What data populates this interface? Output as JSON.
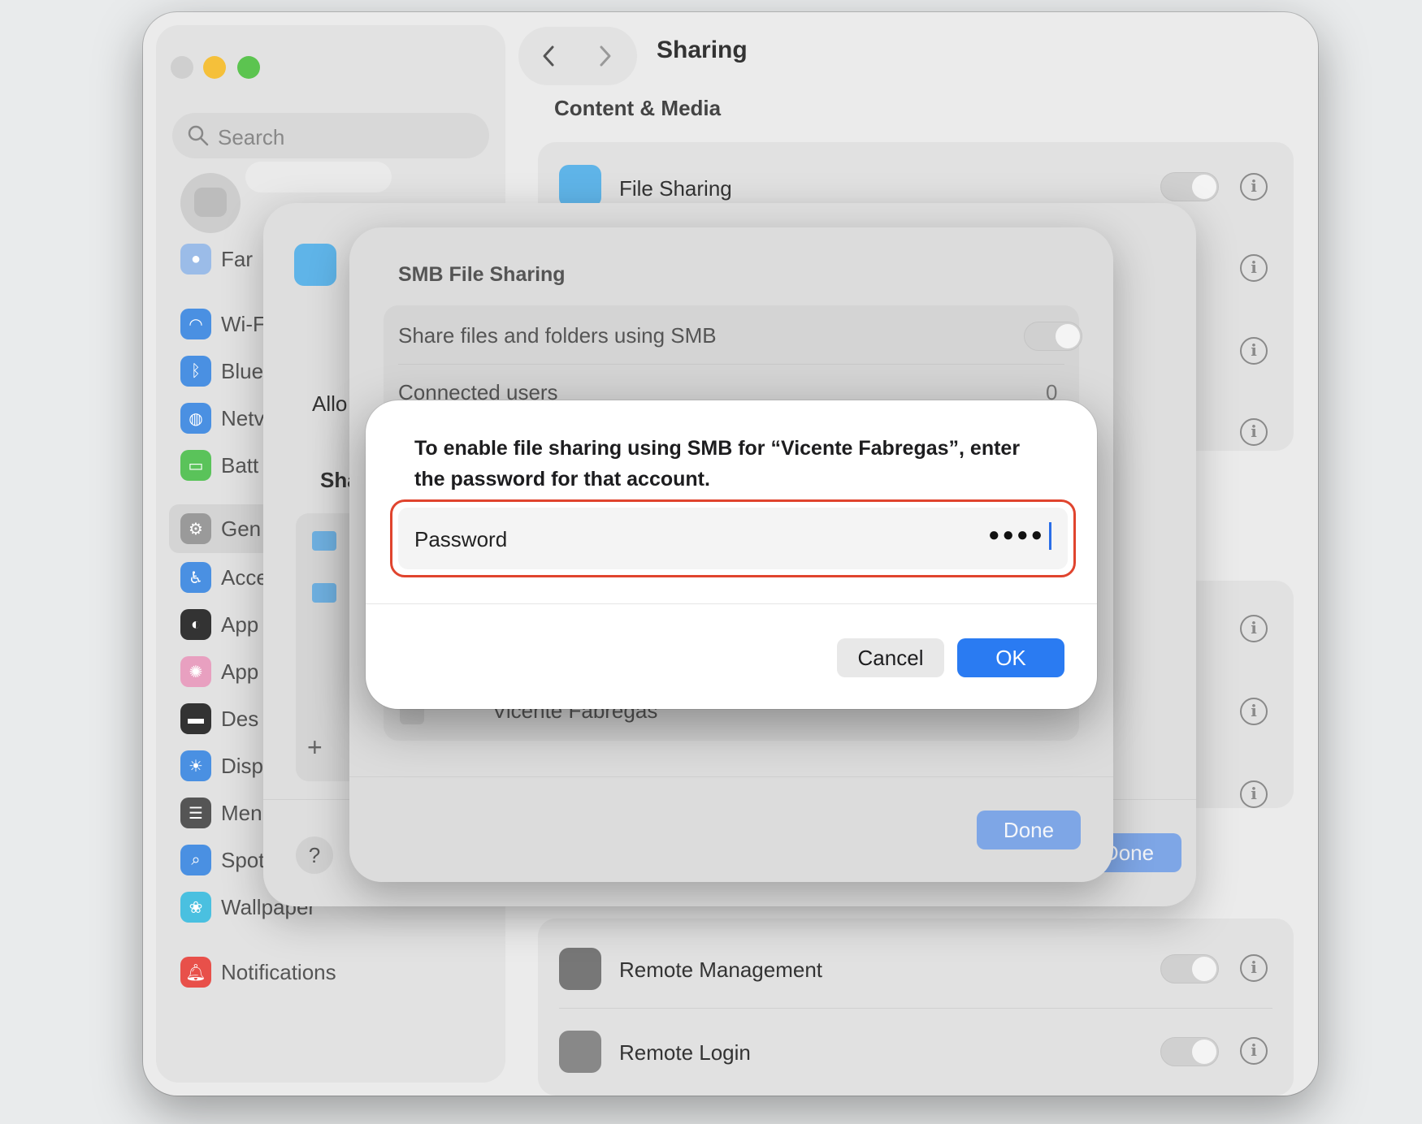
{
  "window": {
    "title": "Sharing"
  },
  "sidebar": {
    "search_placeholder": "Search",
    "items": [
      {
        "label": "Far",
        "icon": "family-icon",
        "color": "#9bbce8"
      },
      {
        "label": "Wi-F",
        "icon": "wifi-icon",
        "color": "#4a90e2"
      },
      {
        "label": "Blue",
        "icon": "bluetooth-icon",
        "color": "#4a90e2"
      },
      {
        "label": "Netv",
        "icon": "network-icon",
        "color": "#4a90e2"
      },
      {
        "label": "Batt",
        "icon": "battery-icon",
        "color": "#5ac35a"
      },
      {
        "label": "Gen",
        "icon": "gear-icon",
        "color": "#9a9a9a"
      },
      {
        "label": "Acce",
        "icon": "accessibility-icon",
        "color": "#4a90e2"
      },
      {
        "label": "App",
        "icon": "appearance-icon",
        "color": "#333333"
      },
      {
        "label": "App",
        "icon": "apple-intelligence-icon",
        "color": "#e8a0c0"
      },
      {
        "label": "Des",
        "icon": "desktop-icon",
        "color": "#333333"
      },
      {
        "label": "Disp",
        "icon": "display-icon",
        "color": "#4a90e2"
      },
      {
        "label": "Men",
        "icon": "menu-bar-icon",
        "color": "#555555"
      },
      {
        "label": "Spotlight",
        "icon": "spotlight-icon",
        "color": "#4a90e2"
      },
      {
        "label": "Wallpaper",
        "icon": "wallpaper-icon",
        "color": "#4ac0e0"
      },
      {
        "label": "Notifications",
        "icon": "notifications-icon",
        "color": "#e8504a"
      }
    ]
  },
  "content": {
    "section": "Content & Media",
    "file_sharing": "File Sharing",
    "remote_management": "Remote Management",
    "remote_login": "Remote Login"
  },
  "sheet1": {
    "allow_label": "Allo",
    "shared_label": "Sha",
    "add": "+",
    "help": "?",
    "done": "Done"
  },
  "sheet2": {
    "title": "SMB File Sharing",
    "share_label": "Share files and folders using SMB",
    "connected_users": "Connected users",
    "connected_count": "0",
    "user": "Vicente Fabregas",
    "done": "Done"
  },
  "alert": {
    "message": "To enable file sharing using SMB for “Vicente Fabregas”, enter the password for that account.",
    "password_label": "Password",
    "password_dots": "●●●●",
    "cancel": "Cancel",
    "ok": "OK"
  }
}
